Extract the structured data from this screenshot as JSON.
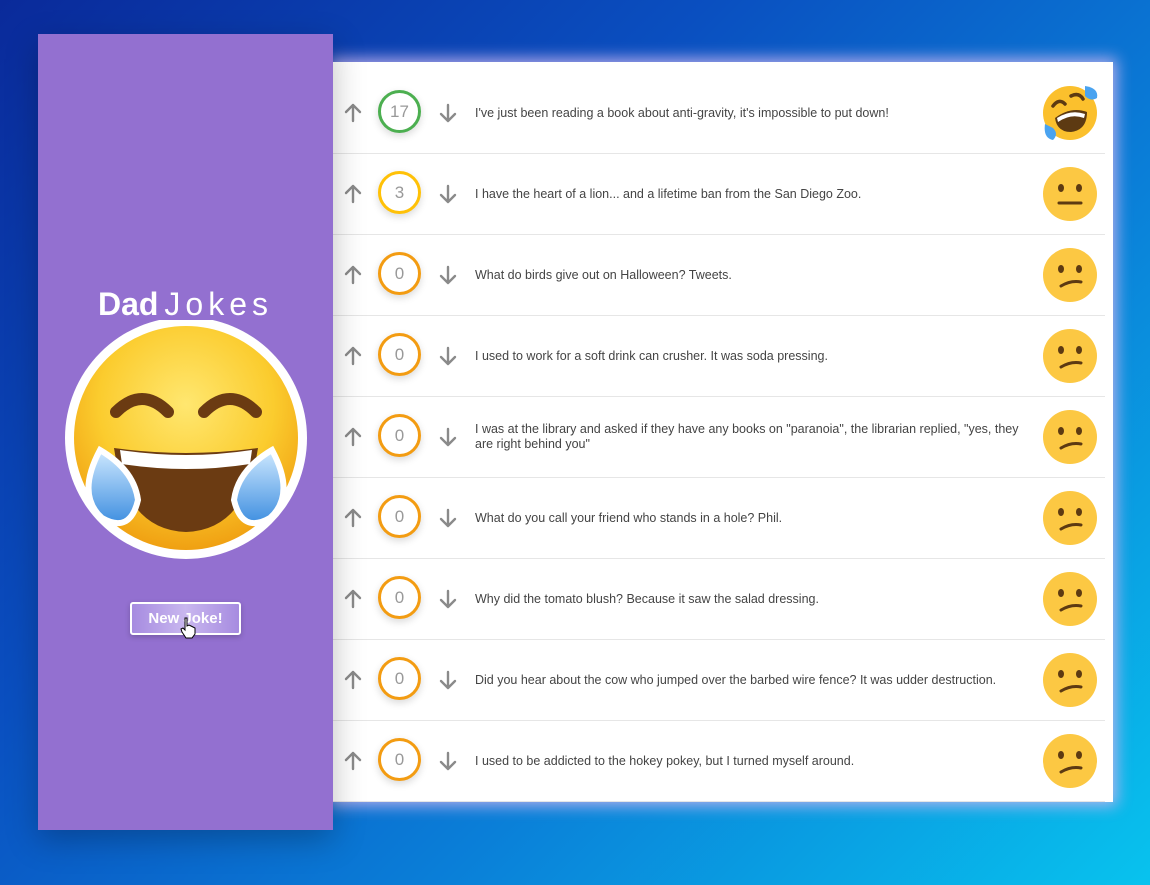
{
  "app": {
    "title_bold": "Dad",
    "title_light": "Jokes",
    "new_joke_label": "New Joke!",
    "hero_icon": "laughing-crying-emoji"
  },
  "colors": {
    "sidebar": "#9370d0",
    "score_high": "#4caf50",
    "score_mid": "#ffc107",
    "score_low": "#f39c12"
  },
  "jokes": [
    {
      "text": "I've just been reading a book about anti-gravity, it's impossible to put down!",
      "score": "17",
      "face": "rolling-laughing-face-icon"
    },
    {
      "text": "I have the heart of a lion... and a lifetime ban from the San Diego Zoo.",
      "score": "3",
      "face": "neutral-face-icon"
    },
    {
      "text": "What do birds give out on Halloween? Tweets.",
      "score": "0",
      "face": "confused-face-icon"
    },
    {
      "text": "I used to work for a soft drink can crusher. It was soda pressing.",
      "score": "0",
      "face": "confused-face-icon"
    },
    {
      "text": "I was at the library and asked if they have any books on \"paranoia\", the librarian replied, \"yes, they are right behind you\"",
      "score": "0",
      "face": "confused-face-icon"
    },
    {
      "text": "What do you call your friend who stands in a hole? Phil.",
      "score": "0",
      "face": "confused-face-icon"
    },
    {
      "text": "Why did the tomato blush? Because it saw the salad dressing.",
      "score": "0",
      "face": "confused-face-icon"
    },
    {
      "text": "Did you hear about the cow who jumped over the barbed wire fence? It was udder destruction.",
      "score": "0",
      "face": "confused-face-icon"
    },
    {
      "text": "I used to be addicted to the hokey pokey, but I turned myself around.",
      "score": "0",
      "face": "confused-face-icon"
    }
  ]
}
